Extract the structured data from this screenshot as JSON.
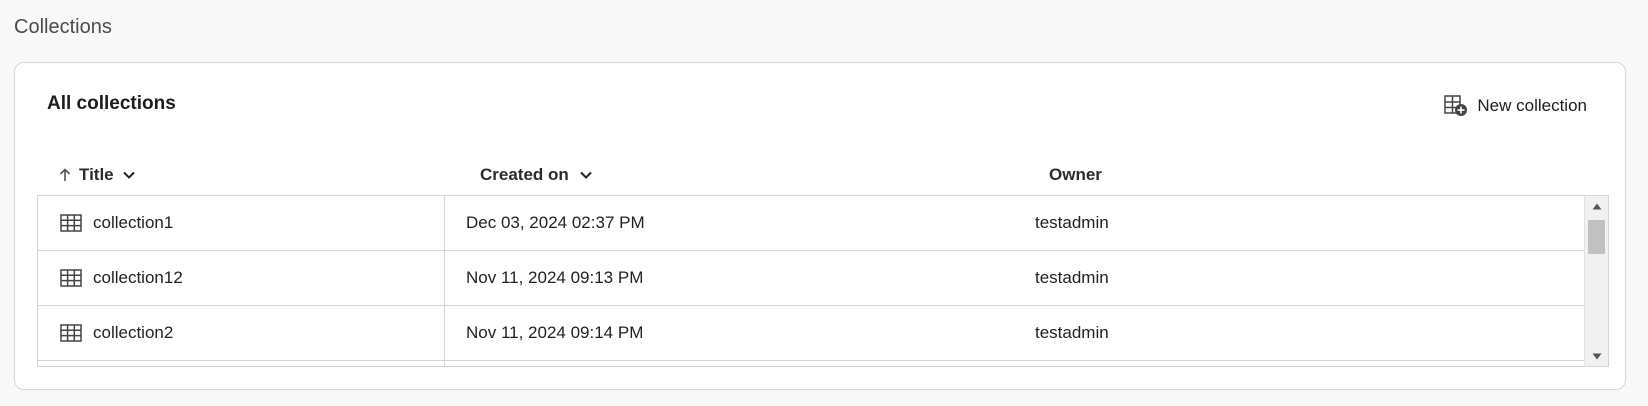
{
  "page": {
    "title": "Collections"
  },
  "card": {
    "heading": "All collections",
    "new_button_label": "New collection"
  },
  "table": {
    "columns": {
      "title": "Title",
      "created_on": "Created on",
      "owner": "Owner"
    },
    "sort": {
      "column": "Title",
      "direction": "ascending"
    },
    "rows": [
      {
        "title": "collection1",
        "created_on": "Dec 03, 2024 02:37 PM",
        "owner": "testadmin"
      },
      {
        "title": "collection12",
        "created_on": "Nov 11, 2024 09:13 PM",
        "owner": "testadmin"
      },
      {
        "title": "collection2",
        "created_on": "Nov 11, 2024 09:14 PM",
        "owner": "testadmin"
      }
    ]
  },
  "icons": {
    "sort": "arrow-up-icon",
    "column_menu": "chevron-down-icon",
    "row": "table-grid-icon",
    "new": "add-collection-icon"
  }
}
